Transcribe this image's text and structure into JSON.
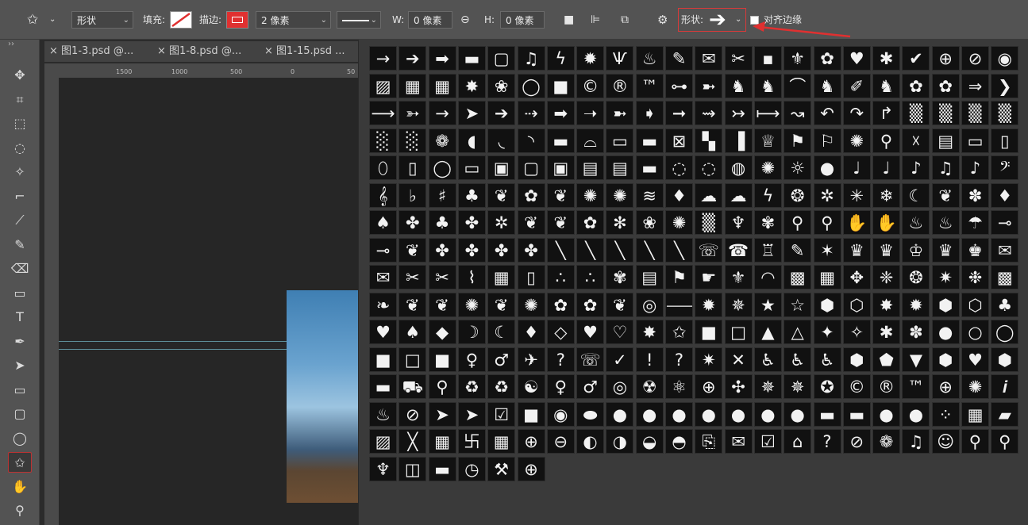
{
  "options_bar": {
    "mode": "形状",
    "fill_label": "填充:",
    "stroke_label": "描边:",
    "stroke_width": "2 像素",
    "w_label": "W:",
    "w_value": "0 像素",
    "h_label": "H:",
    "h_value": "0 像素",
    "shape_label": "形状:",
    "align_edges_label": "对齐边缘",
    "stroke_color": "#e03030",
    "annotation_color": "#e03030"
  },
  "tabs": [
    {
      "label": "图1-3.psd @..."
    },
    {
      "label": "图1-8.psd @..."
    },
    {
      "label": "图1-15.psd ..."
    }
  ],
  "ruler": {
    "h_ticks": [
      "1500",
      "1000",
      "500",
      "0",
      "50"
    ],
    "v_ticks": [
      "0",
      "1\n5\n0\n0",
      "1\n0\n0\n0",
      "5\n0\n0",
      "0",
      "5\n0\n0",
      "1\n0\n0\n0",
      "1\n5\n0\n0"
    ]
  },
  "tools": [
    {
      "name": "move-tool-icon",
      "glyph": "✥"
    },
    {
      "name": "artboard-tool-icon",
      "glyph": "⌗"
    },
    {
      "name": "marquee-tool-icon",
      "glyph": "⬚"
    },
    {
      "name": "lasso-tool-icon",
      "glyph": "◌"
    },
    {
      "name": "magic-wand-tool-icon",
      "glyph": "✧"
    },
    {
      "name": "crop-tool-icon",
      "glyph": "⌐"
    },
    {
      "name": "eyedropper-tool-icon",
      "glyph": "⟋"
    },
    {
      "name": "brush-tool-icon",
      "glyph": "✎"
    },
    {
      "name": "eraser-tool-icon",
      "glyph": "⌫"
    },
    {
      "name": "gradient-tool-icon",
      "glyph": "▭"
    },
    {
      "name": "type-tool-icon",
      "glyph": "T"
    },
    {
      "name": "pen-tool-icon",
      "glyph": "✒"
    },
    {
      "name": "path-selection-tool-icon",
      "glyph": "➤"
    },
    {
      "name": "rectangle-tool-icon",
      "glyph": "▭"
    },
    {
      "name": "rounded-rectangle-tool-icon",
      "glyph": "▢"
    },
    {
      "name": "ellipse-tool-icon",
      "glyph": "◯"
    },
    {
      "name": "custom-shape-tool-icon",
      "glyph": "✩"
    },
    {
      "name": "hand-tool-icon",
      "glyph": "✋"
    },
    {
      "name": "zoom-tool-icon",
      "glyph": "⚲"
    }
  ],
  "shapes": [
    "→",
    "➔",
    "➡",
    "▬",
    "▢",
    "♫",
    "ϟ",
    "✹",
    "Ѱ",
    "♨",
    "✎",
    "✉",
    "✂",
    "▪",
    "⚜",
    "✿",
    "♥",
    "✱",
    "✔",
    "⊕",
    "⊘",
    "◉",
    "▨",
    "▦",
    "▦",
    "✸",
    "❀",
    "◯",
    "■",
    "©",
    "®",
    "™",
    "⊶",
    "➼",
    "♞",
    "♞",
    "⌒",
    "♞",
    "✐",
    "♞",
    "✿",
    "✿",
    "⇒",
    "❯",
    "⟶",
    "➳",
    "→",
    "➤",
    "➔",
    "⇢",
    "➡",
    "➝",
    "➼",
    "➧",
    "➞",
    "⇝",
    "↣",
    "⟼",
    "↝",
    "↶",
    "↷",
    "↱",
    "▒",
    "▒",
    "▒",
    "▒",
    "░",
    "░",
    "❁",
    "◖",
    "◟",
    "◝",
    "▬",
    "⌓",
    "▭",
    "▬",
    "⊠",
    "▚",
    "▐",
    "♕",
    "⚑",
    "⚐",
    "✺",
    "⚲",
    "☓",
    "▤",
    "▭",
    "▯",
    "⬯",
    "▯",
    "◯",
    "▭",
    "▣",
    "▢",
    "▣",
    "▤",
    "▤",
    "▬",
    "◌",
    "◌",
    "◍",
    "✺",
    "☼",
    "●",
    "♩",
    "♩",
    "♪",
    "♫",
    "♪",
    "𝄢",
    "𝄞",
    "♭",
    "♯",
    "♣",
    "❦",
    "✿",
    "❦",
    "✺",
    "✺",
    "≋",
    "♦",
    "☁",
    "☁",
    "ϟ",
    "❂",
    "✲",
    "✳",
    "❄",
    "☾",
    "❦",
    "✽",
    "♦",
    "♠",
    "✤",
    "♣",
    "✤",
    "✲",
    "❦",
    "❦",
    "✿",
    "✻",
    "❀",
    "✺",
    "▒",
    "♆",
    "✾",
    "⚲",
    "⚲",
    "✋",
    "✋",
    "♨",
    "♨",
    "☂",
    "⊸",
    "⊸",
    "❦",
    "✤",
    "✤",
    "✤",
    "✤",
    "╲",
    "╲",
    "╲",
    "╲",
    "╲",
    "☏",
    "☎",
    "♖",
    "✎",
    "✶",
    "♛",
    "♛",
    "♔",
    "♛",
    "♚",
    "✉",
    "✉",
    "✂",
    "✂",
    "⌇",
    "▦",
    "▯",
    "∴",
    "∴",
    "✾",
    "▤",
    "⚑",
    "☛",
    "⚜",
    "◠",
    "▩",
    "▦",
    "✥",
    "❈",
    "❂",
    "✷",
    "❉",
    "▩",
    "❧",
    "❦",
    "❦",
    "✺",
    "❦",
    "✺",
    "✿",
    "✿",
    "❦",
    "◎",
    "⸻",
    "✹",
    "✵",
    "★",
    "☆",
    "⬢",
    "⬡",
    "✸",
    "✹",
    "⬢",
    "⬡",
    "♣",
    "♥",
    "♠",
    "◆",
    "☽",
    "☾",
    "♦",
    "◇",
    "♥",
    "♡",
    "✸",
    "✩",
    "■",
    "□",
    "▲",
    "△",
    "✦",
    "✧",
    "✱",
    "✽",
    "●",
    "○",
    "◯",
    "■",
    "□",
    "■",
    "♀",
    "♂",
    "✈",
    "?",
    "☏",
    "✓",
    "!",
    "?",
    "✷",
    "✕",
    "♿",
    "♿",
    "♿",
    "⬢",
    "⬟",
    "▼",
    "⬢",
    "♥",
    "⬢",
    "▬",
    "⛟",
    "⚲",
    "♻",
    "♻",
    "☯",
    "♀",
    "♂",
    "◎",
    "☢",
    "⚛",
    "⊕",
    "✣",
    "✵",
    "✵",
    "✪",
    "©",
    "®",
    "™",
    "⊕",
    "✺",
    "𝒊",
    "♨",
    "⊘",
    "➤",
    "➤",
    "☑",
    "■",
    "◉",
    "⬬",
    "●",
    "●",
    "●",
    "●",
    "●",
    "●",
    "●",
    "▬",
    "▬",
    "●",
    "●",
    "⁘",
    "▦",
    "▰",
    "▨",
    "╳",
    "▦",
    "卐",
    "▦",
    "⊕",
    "⊖",
    "◐",
    "◑",
    "◒",
    "◓",
    "⎘",
    "✉",
    "☑",
    "⌂",
    "?",
    "⊘",
    "❁",
    "♫",
    "☺",
    "⚲",
    "⚲",
    "♆",
    "◫",
    "▬",
    "◷",
    "⚒",
    "⊕"
  ]
}
